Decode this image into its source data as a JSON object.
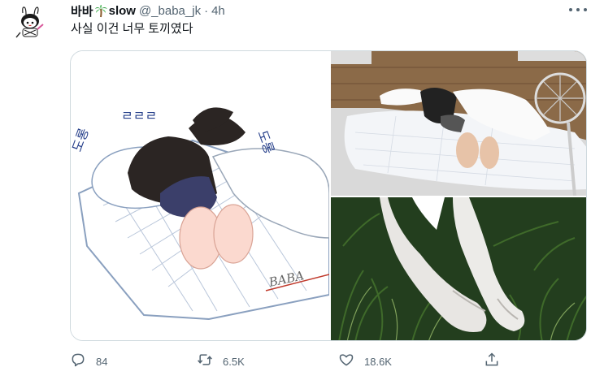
{
  "author": {
    "name_part1": "바바",
    "name_part2": "slow",
    "handle": "@_baba_jk",
    "separator": "·",
    "time": "4h"
  },
  "tweet": {
    "text": "사실 이건 너무 토끼였다"
  },
  "illustration": {
    "sfx_left": "도롱",
    "sfx_right": "도롱",
    "zzz": "ㄹㄹㄹ",
    "signature": "BABA"
  },
  "actions": {
    "replies": "84",
    "retweets": "6.5K",
    "likes": "18.6K"
  },
  "colors": {
    "icon_gray": "#536471",
    "border": "#cfd9de",
    "text": "#0f1419"
  },
  "icons": [
    "avatar",
    "palm-tree-icon",
    "more-icon",
    "reply-icon",
    "retweet-icon",
    "like-icon",
    "share-icon"
  ]
}
